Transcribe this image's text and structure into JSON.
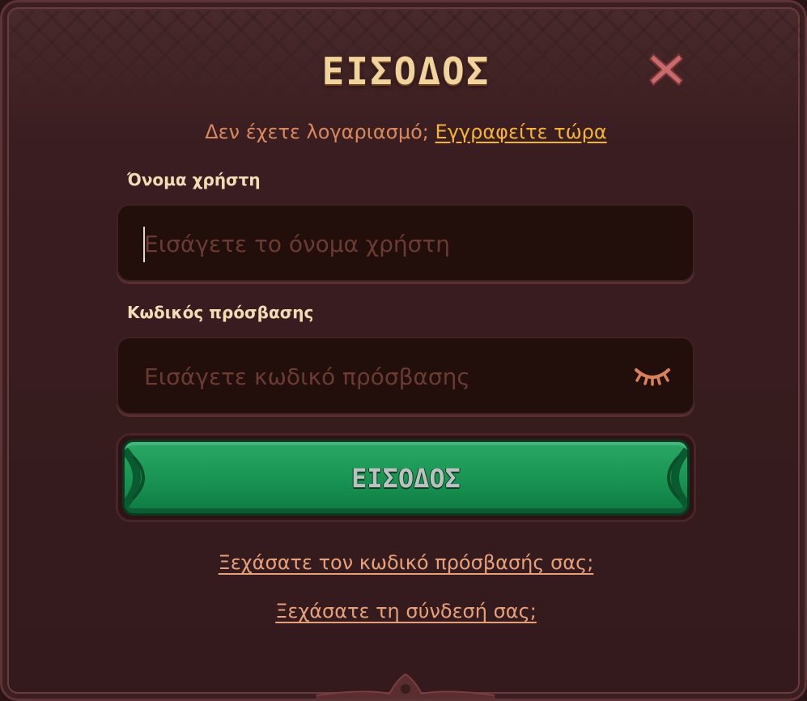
{
  "dialog": {
    "title": "ΕΙΣΟΔΟΣ",
    "close_icon": "close-x-icon",
    "register_prompt": "Δεν έχετε λογαριασμό;",
    "register_link": "Εγγραφείτε τώρα"
  },
  "form": {
    "username_label": "Όνομα χρήστη",
    "username_placeholder": "Εισάγετε το όνομα χρήστη",
    "username_value": "",
    "password_label": "Κωδικός πρόσβασης",
    "password_placeholder": "Εισάγετε κωδικό πρόσβασης",
    "password_value": "",
    "password_toggle_icon": "eye-closed-icon",
    "submit_label": "ΕΙΣΟΔΟΣ"
  },
  "links": {
    "forgot_password": "Ξεχάσατε τον κωδικό πρόσβασής σας;",
    "forgot_login": "Ξεχάσατε τη σύνδεσή σας;"
  },
  "colors": {
    "title": "#f1d39e",
    "accent_link": "#f4b43a",
    "button_green": "#189352",
    "panel": "#341a1d"
  }
}
